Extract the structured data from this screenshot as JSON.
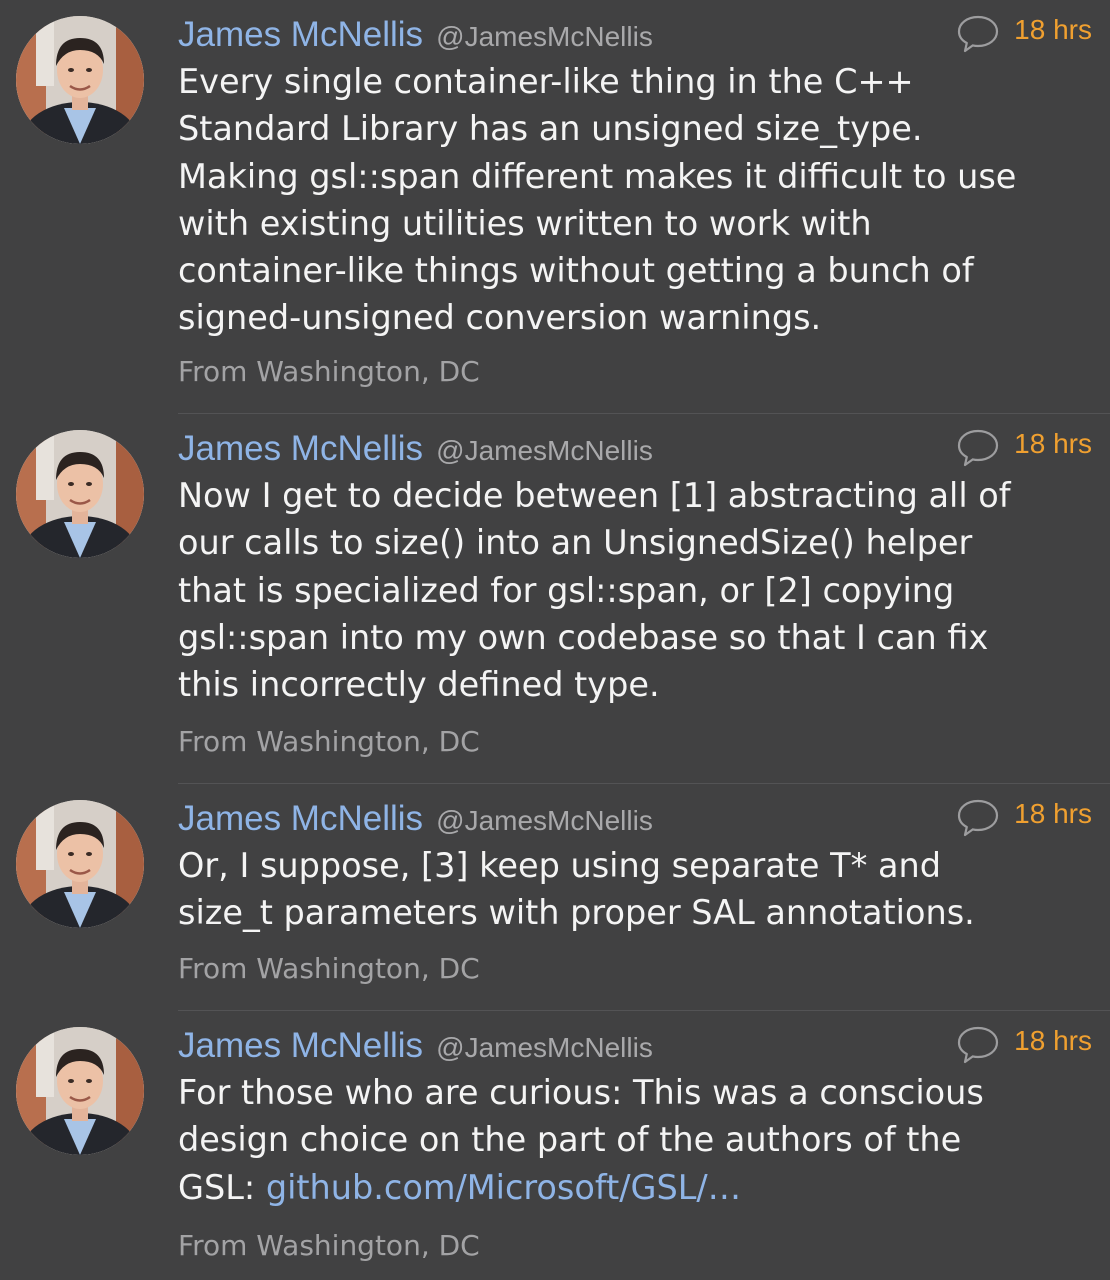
{
  "tweets": [
    {
      "author": "James McNellis",
      "handle": "@JamesMcNellis",
      "time": "18 hrs",
      "lines": [
        "Every single container-like thing in the C++",
        "Standard Library has an unsigned size_type.",
        "Making gsl::span different makes it difficult to use",
        "with existing utilities written to work with",
        "container-like things without getting a bunch of",
        "signed-unsigned conversion warnings."
      ],
      "location": "From Washington, DC"
    },
    {
      "author": "James McNellis",
      "handle": "@JamesMcNellis",
      "time": "18 hrs",
      "lines": [
        "Now I get to decide between [1] abstracting all of",
        "our calls to size() into an UnsignedSize() helper",
        "that is specialized for gsl::span, or [2] copying",
        "gsl::span into my own codebase so that I can fix",
        "this incorrectly defined type."
      ],
      "location": "From Washington, DC"
    },
    {
      "author": "James McNellis",
      "handle": "@JamesMcNellis",
      "time": "18 hrs",
      "lines": [
        "Or, I suppose, [3] keep using separate T* and",
        "size_t parameters with proper SAL annotations."
      ],
      "location": "From Washington, DC"
    },
    {
      "author": "James McNellis",
      "handle": "@JamesMcNellis",
      "time": "18 hrs",
      "lines": [
        "For those who are curious:  This was a conscious",
        "design choice on the part of the authors of the"
      ],
      "last_line_prefix": "GSL: ",
      "link_text": "github.com/Microsoft/GSL/…",
      "location": "From Washington, DC"
    }
  ],
  "colors": {
    "background": "#414142",
    "author_name": "#8fb4e6",
    "handle": "#a9a9ab",
    "timestamp": "#f0a030",
    "body_text": "#f4f4f4",
    "location": "#a3a3a5",
    "link": "#8fb4e6",
    "divider": "#535355"
  },
  "icons": {
    "reply": "speech-bubble-icon",
    "avatar": "user-avatar-photo"
  }
}
